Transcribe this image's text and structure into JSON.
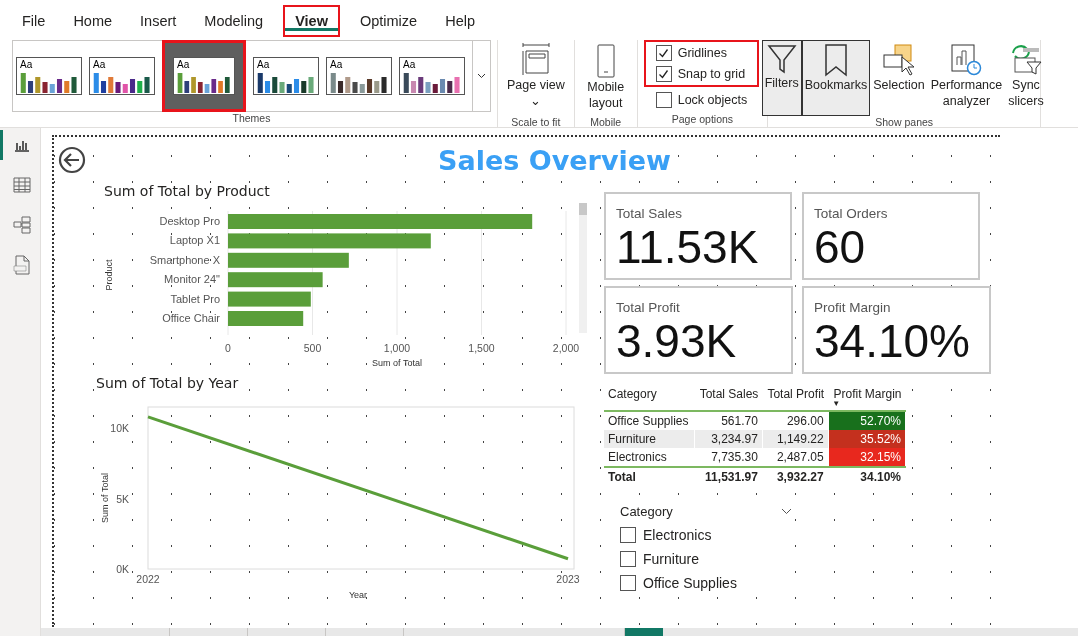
{
  "menu_tabs": [
    {
      "label": "File",
      "selected": false,
      "highlighted": false
    },
    {
      "label": "Home",
      "selected": false,
      "highlighted": false
    },
    {
      "label": "Insert",
      "selected": false,
      "highlighted": false
    },
    {
      "label": "Modeling",
      "selected": false,
      "highlighted": false
    },
    {
      "label": "View",
      "selected": true,
      "highlighted": true
    },
    {
      "label": "Optimize",
      "selected": false,
      "highlighted": false
    },
    {
      "label": "Help",
      "selected": false,
      "highlighted": false
    }
  ],
  "ribbon": {
    "themes": {
      "label": "Themes",
      "items": [
        {
          "selected": false,
          "sample": "Aa"
        },
        {
          "selected": false,
          "sample": "Aa"
        },
        {
          "selected": true,
          "sample": "Aa"
        },
        {
          "selected": false,
          "sample": "Aa"
        },
        {
          "selected": false,
          "sample": "Aa"
        },
        {
          "selected": false,
          "sample": "Aa"
        }
      ]
    },
    "scale": {
      "label": "Scale to fit",
      "button": "Page view",
      "caret": "⌄"
    },
    "mobile": {
      "label": "Mobile",
      "button": "Mobile layout"
    },
    "page_options": {
      "label": "Page options",
      "options": [
        {
          "label": "Gridlines",
          "checked": true,
          "highlighted": true
        },
        {
          "label": "Snap to grid",
          "checked": true,
          "highlighted": true
        },
        {
          "label": "Lock objects",
          "checked": false,
          "highlighted": false
        }
      ]
    },
    "panes": {
      "label": "Show panes",
      "buttons": [
        {
          "kind": "filters",
          "label": "Filters",
          "selected": true
        },
        {
          "kind": "bookmarks",
          "label": "Bookmarks",
          "selected": true
        },
        {
          "kind": "selection",
          "label": "Selection",
          "selected": false
        },
        {
          "kind": "performance",
          "label": "Performance analyzer",
          "selected": false
        },
        {
          "kind": "sync",
          "label": "Sync slicers",
          "selected": false
        }
      ]
    }
  },
  "sidebar": {
    "views": [
      {
        "kind": "report",
        "selected": true
      },
      {
        "kind": "table",
        "selected": false
      },
      {
        "kind": "model",
        "selected": false
      },
      {
        "kind": "dax",
        "selected": false
      }
    ]
  },
  "report": {
    "title": "Sales Overview",
    "bar_chart": {
      "title": "Sum of Total by Product",
      "chart_data": {
        "type": "bar",
        "orientation": "horizontal",
        "xlabel": "Sum of Total",
        "ylabel": "Product",
        "categories": [
          "Desktop Pro",
          "Laptop X1",
          "Smartphone X",
          "Monitor 24\"",
          "Tablet Pro",
          "Office Chair"
        ],
        "series": [
          {
            "color": "#5a9e3a",
            "values": [
              1800,
              1200,
              715,
              560,
              490,
              445
            ]
          }
        ],
        "grid": true,
        "xlim": [
          0,
          2000
        ],
        "xticks": [
          {
            "value": 0,
            "label": "0"
          },
          {
            "value": 500,
            "label": "500"
          },
          {
            "value": 1000,
            "label": "1,000"
          },
          {
            "value": 1500,
            "label": "1,500"
          },
          {
            "value": 2000,
            "label": "2,000"
          }
        ]
      }
    },
    "line_chart": {
      "title": "Sum of Total by Year",
      "chart_data": {
        "type": "line",
        "xlabel": "Year",
        "ylabel": "Sum of Total",
        "categories": [
          "2022",
          "2023"
        ],
        "series": [
          {
            "color": "#5a9e3a",
            "values": [
              10800,
              730
            ]
          }
        ],
        "ylim": [
          0,
          11500
        ],
        "yticks": [
          {
            "value": 0,
            "label": "0K"
          },
          {
            "value": 5000,
            "label": "5K"
          },
          {
            "value": 10000,
            "label": "10K"
          }
        ]
      }
    },
    "cards": [
      {
        "label": "Total Sales",
        "value": "11.53K"
      },
      {
        "label": "Total Orders",
        "value": "60"
      },
      {
        "label": "Total Profit",
        "value": "3.93K"
      },
      {
        "label": "Profit Margin",
        "value": "34.10%"
      }
    ],
    "table": {
      "columns": [
        "Category",
        "Total Sales",
        "Total Profit",
        "Profit Margin"
      ],
      "sort_mark": "▼",
      "rows": [
        {
          "cells": [
            "Office Supplies",
            "561.70",
            "296.00",
            "52.70%"
          ],
          "color": "#18701c",
          "hovered": false
        },
        {
          "cells": [
            "Furniture",
            "3,234.97",
            "1,149.22",
            "35.52%"
          ],
          "color": "#c4301e",
          "hovered": true
        },
        {
          "cells": [
            "Electronics",
            "7,735.30",
            "2,487.05",
            "32.15%"
          ],
          "color": "#e8281e",
          "hovered": false
        }
      ],
      "total": [
        "Total",
        "11,531.97",
        "3,932.27",
        "34.10%"
      ]
    },
    "slicer": {
      "title": "Category",
      "items": [
        {
          "label": "Electronics",
          "checked": false
        },
        {
          "label": "Furniture",
          "checked": false
        },
        {
          "label": "Office Supplies",
          "checked": false
        }
      ]
    }
  },
  "page_tabs": [
    {
      "selected": false
    },
    {
      "selected": false
    },
    {
      "selected": false
    },
    {
      "selected": false
    },
    {
      "selected": true
    }
  ]
}
